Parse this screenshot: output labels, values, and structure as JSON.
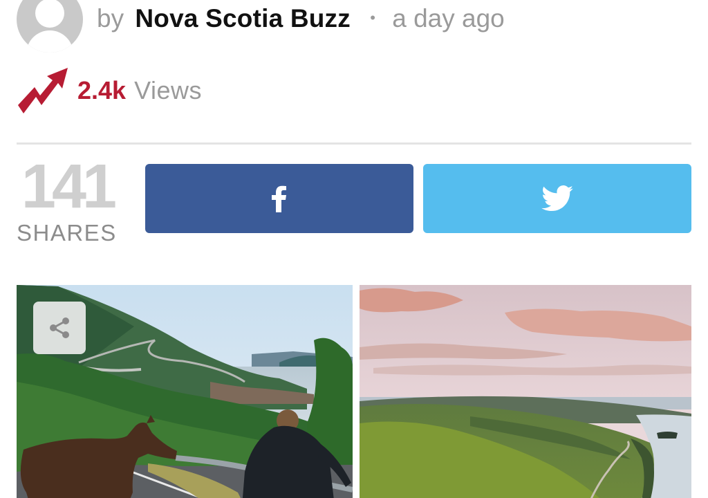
{
  "author": {
    "by_label": "by",
    "name": "Nova Scotia Buzz",
    "dot": "•",
    "time": "a day ago"
  },
  "stats": {
    "views_count": "2.4k",
    "views_label": "Views",
    "share_count": "141",
    "share_label": "SHARES"
  },
  "buttons": {
    "facebook_icon": "facebook-icon",
    "twitter_icon": "twitter-icon"
  },
  "images": {
    "left_icon": "share-icon"
  },
  "colors": {
    "views_accent": "#b71c33",
    "facebook": "#3b5b98",
    "twitter": "#55bdee"
  }
}
